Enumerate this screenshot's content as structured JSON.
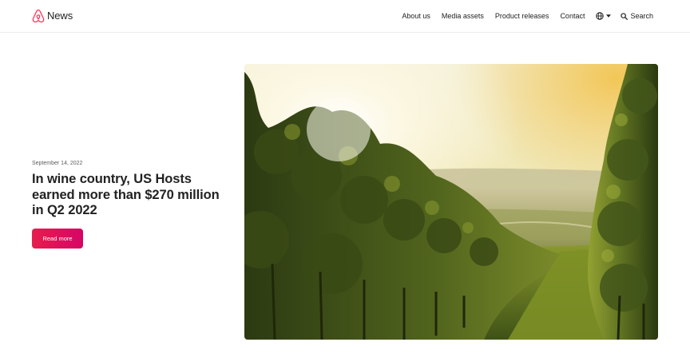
{
  "header": {
    "brand_text": "News",
    "nav": [
      {
        "label": "About us"
      },
      {
        "label": "Media assets"
      },
      {
        "label": "Product releases"
      },
      {
        "label": "Contact"
      }
    ],
    "language_icon": "globe-icon",
    "search_label": "Search"
  },
  "hero": {
    "date": "September 14, 2022",
    "headline": "In wine country, US Hosts earned more than $270 million in Q2 2022",
    "cta_label": "Read more",
    "image_subject": "vineyard-at-sunset"
  },
  "colors": {
    "brand": "#FF385C",
    "cta_start": "#E61E4D",
    "cta_end": "#D70466",
    "text": "#222222",
    "divider": "#EBEBEB"
  }
}
